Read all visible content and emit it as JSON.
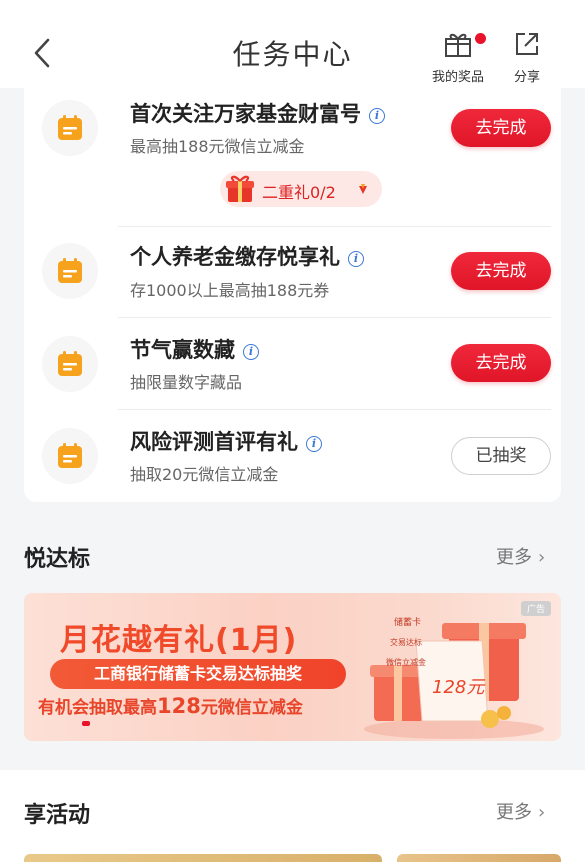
{
  "header": {
    "title": "任务中心",
    "my_prizes_label": "我的奖品",
    "share_label": "分享"
  },
  "tasks": [
    {
      "title": "首次关注万家基金财富号",
      "subtitle": "最高抽188元微信立减金",
      "button": "去完成",
      "button_style": "primary"
    },
    {
      "title": "个人养老金缴存悦享礼",
      "subtitle": "存1000以上最高抽188元券",
      "button": "去完成",
      "button_style": "primary"
    },
    {
      "title": "节气赢数藏",
      "subtitle": "抽限量数字藏品",
      "button": "去完成",
      "button_style": "primary"
    },
    {
      "title": "风险评测首评有礼",
      "subtitle": "抽取20元微信立减金",
      "button": "已抽奖",
      "button_style": "outline"
    }
  ],
  "bonus": {
    "label": "二重礼0/2"
  },
  "section_yuedabiao": {
    "title": "悦达标",
    "more": "更多"
  },
  "banner": {
    "ad_tag": "广告",
    "title": "月花越有礼(1月)",
    "subtitle": "工商银行储蓄卡交易达标抽奖",
    "desc_prefix": "有机会抽取最高",
    "desc_amount": "128",
    "desc_suffix": "元微信立减金",
    "art_tags": [
      "储蓄卡",
      "交易达标",
      "微信立减金"
    ],
    "art_amount": "128元"
  },
  "section_xianghuodong": {
    "title": "享活动",
    "more": "更多"
  },
  "colors": {
    "primary_red": "#e8132a",
    "banner_orange": "#f04a2a",
    "info_blue": "#3b78d8",
    "task_icon_orange": "#f6a21c"
  }
}
